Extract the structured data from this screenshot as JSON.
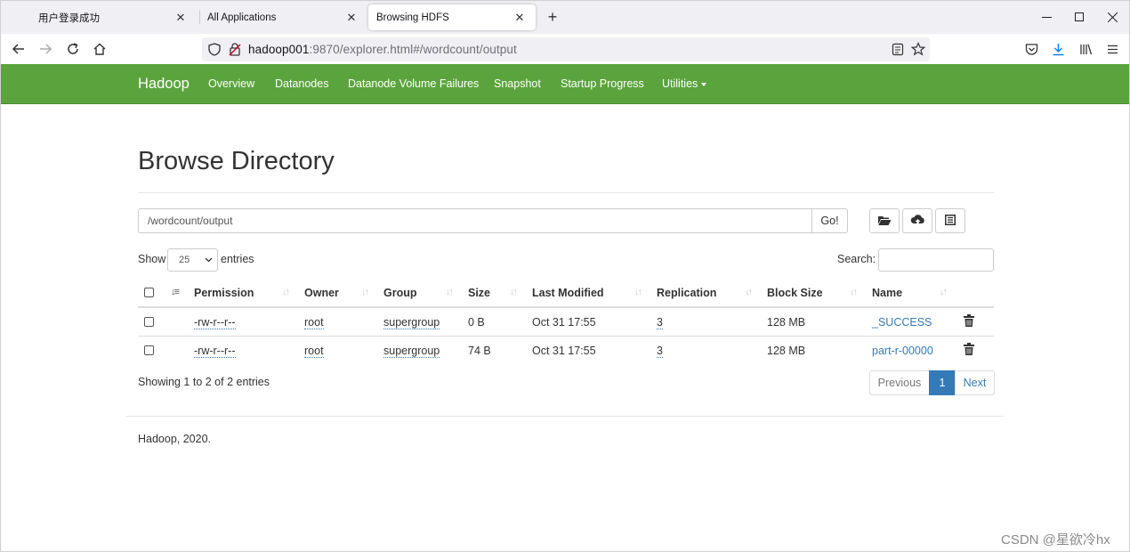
{
  "browser": {
    "tabs": [
      {
        "title": "用户登录成功"
      },
      {
        "title": "All Applications"
      },
      {
        "title": "Browsing HDFS",
        "active": true
      }
    ],
    "url_host": "hadoop001",
    "url_rest": ":9870/explorer.html#/wordcount/output"
  },
  "nav": {
    "brand": "Hadoop",
    "items": [
      "Overview",
      "Datanodes",
      "Datanode Volume Failures",
      "Snapshot",
      "Startup Progress",
      "Utilities"
    ]
  },
  "page": {
    "title": "Browse Directory",
    "path_value": "/wordcount/output",
    "go_label": "Go!",
    "show_label": "Show",
    "entries_value": "25",
    "entries_label": "entries",
    "search_label": "Search:",
    "showing_text": "Showing 1 to 2 of 2 entries",
    "pagination": {
      "previous": "Previous",
      "current": "1",
      "next": "Next"
    },
    "footer": "Hadoop, 2020."
  },
  "table": {
    "headers": [
      "Permission",
      "Owner",
      "Group",
      "Size",
      "Last Modified",
      "Replication",
      "Block Size",
      "Name"
    ],
    "rows": [
      {
        "permission": "-rw-r--r--",
        "owner": "root",
        "group": "supergroup",
        "size": "0 B",
        "modified": "Oct 31 17:55",
        "replication": "3",
        "block_size": "128 MB",
        "name": "_SUCCESS"
      },
      {
        "permission": "-rw-r--r--",
        "owner": "root",
        "group": "supergroup",
        "size": "74 B",
        "modified": "Oct 31 17:55",
        "replication": "3",
        "block_size": "128 MB",
        "name": "part-r-00000"
      }
    ]
  },
  "watermark": "CSDN @星欲冷hx",
  "colors": {
    "navbar": "#5ba43d",
    "link": "#337ab7"
  }
}
